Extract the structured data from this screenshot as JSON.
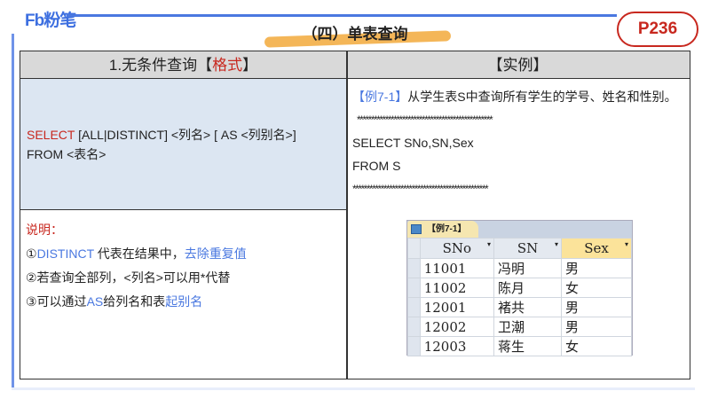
{
  "brand": "Fb粉笔",
  "section_title": "（四）单表查询",
  "page_badge": "P236",
  "table": {
    "left_header": {
      "prefix": "1.无条件查询【",
      "highlight": "格式",
      "suffix": "】"
    },
    "right_header": "【实例】",
    "format": {
      "keyword": "SELECT",
      "line1_rest": " [ALL|DISTINCT] <列名> [ AS  <列别名>]",
      "line2": "FROM <表名>"
    },
    "notes": {
      "title": "说明：",
      "n1": {
        "a": "①",
        "b": "DISTINCT",
        "c": " 代表在结果中，",
        "d": "去除重复值"
      },
      "n2": "②若查询全部列，<列名>可以用*代替",
      "n3": {
        "a": "③可以通过",
        "b": "AS",
        "c": "给列名和表",
        "d": "起别名"
      }
    },
    "example": {
      "tag": "【例7-1】",
      "desc": "从学生表S中查询所有学生的学号、姓名和性别。",
      "stars1": "************************************************",
      "sql1": "SELECT SNo,SN,Sex",
      "sql2": "FROM S",
      "stars2": "************************************************"
    },
    "result": {
      "tab": "【例7-1】",
      "columns": [
        "SNo",
        "SN",
        "Sex"
      ],
      "rows": [
        [
          "11001",
          "冯明",
          "男"
        ],
        [
          "11002",
          "陈月",
          "女"
        ],
        [
          "12001",
          "褚共",
          "男"
        ],
        [
          "12002",
          "卫潮",
          "男"
        ],
        [
          "12003",
          "蒋生",
          "女"
        ]
      ]
    }
  }
}
